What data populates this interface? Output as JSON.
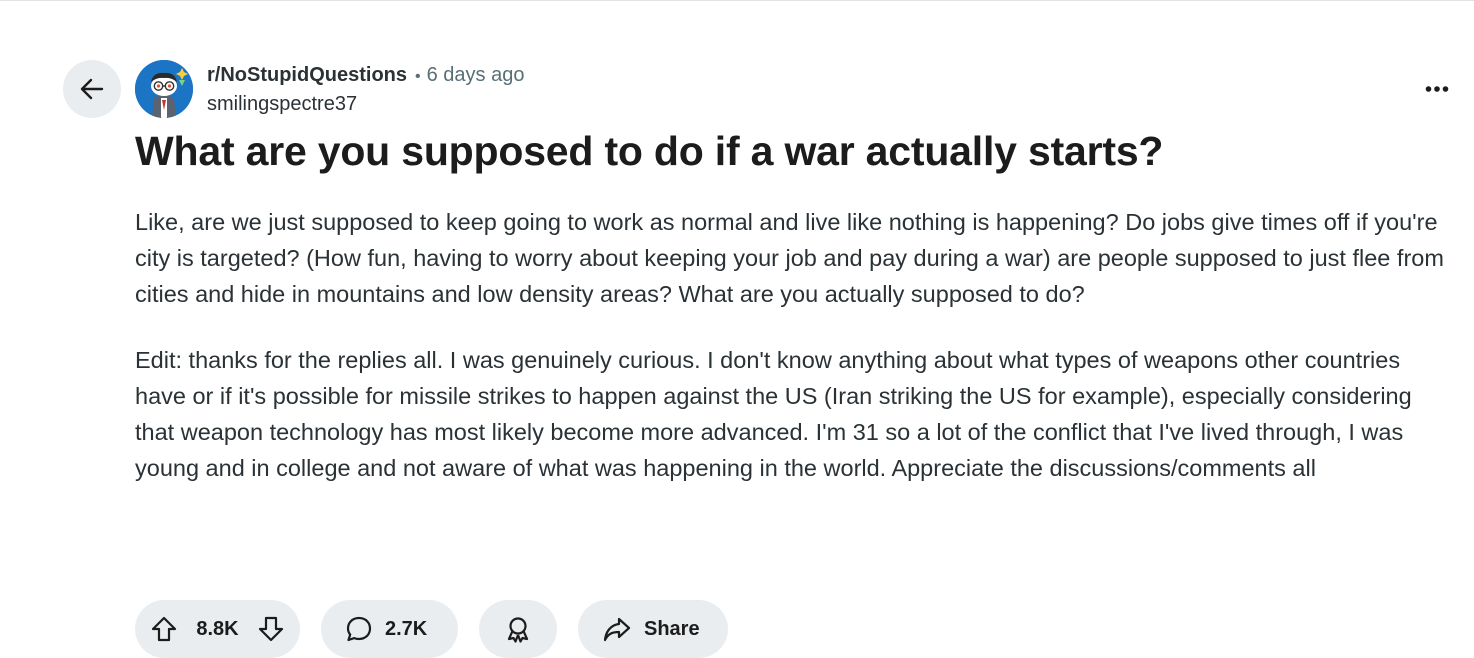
{
  "post": {
    "subreddit": "r/NoStupidQuestions",
    "separator": "•",
    "time_ago": "6 days ago",
    "author": "smilingspectre37",
    "title": "What are you supposed to do if a war actually starts?",
    "body_paragraphs": [
      "Like, are we just supposed to keep going to work as normal and live like nothing is happening? Do jobs give times off if you're city is targeted? (How fun, having to worry about keeping your job and pay during a war) are people supposed to just flee from cities and hide in mountains and low density areas? What are you actually supposed to do?",
      "Edit: thanks for the replies all. I was genuinely curious. I don't know anything about what types of weapons other countries have or if it's possible for missile strikes to happen against the US (Iran striking the US for example), especially considering that weapon technology has most likely become more advanced. I'm 31 so a lot of the conflict that I've lived through, I was young and in college and not aware of what was happening in the world. Appreciate the discussions/comments all"
    ]
  },
  "actions": {
    "vote_count": "8.8K",
    "comment_count": "2.7K",
    "share_label": "Share"
  },
  "icons": {
    "back": "arrow-left-icon",
    "more": "ellipsis-icon",
    "upvote": "arrow-up-icon",
    "downvote": "arrow-down-icon",
    "comment": "speech-bubble-icon",
    "award": "award-ribbon-icon",
    "share": "share-arrow-icon"
  },
  "colors": {
    "pill_background": "#eaedef",
    "avatar_background": "#1c74c4",
    "meta_gray": "#576f76",
    "text": "#1c1c1c"
  }
}
